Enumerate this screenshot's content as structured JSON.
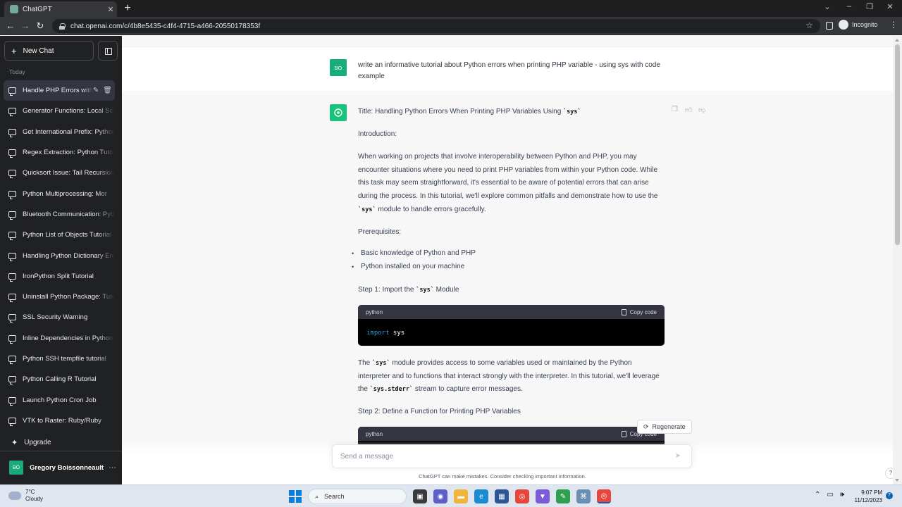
{
  "browser": {
    "tab_title": "ChatGPT",
    "url": "chat.openai.com/c/4b8e5435-c4f4-4715-a466-20550178353f",
    "profile_label": "Incognito"
  },
  "sidebar": {
    "new_chat_label": "New Chat",
    "section_label": "Today",
    "conversations": [
      "Handle PHP Errors with sys",
      "Generator Functions: Local Scope",
      "Get International Prefix: Python",
      "Regex Extraction: Python Tutorial",
      "Quicksort Issue: Tail Recursion",
      "Python Multiprocessing: Mor",
      "Bluetooth Communication: Python",
      "Python List of Objects Tutorial",
      "Handling Python Dictionary Errors",
      "IronPython Split Tutorial",
      "Uninstall Python Package: Tutorial",
      "SSL Security Warning",
      "Inline Dependencies in Python",
      "Python SSH tempfile tutorial",
      "Python Calling R Tutorial",
      "Launch Python Cron Job",
      "VTK to Raster: Ruby/Ruby"
    ],
    "upgrade_label": "Upgrade",
    "user_initials": "BO",
    "user_name": "Gregory Boissonneault"
  },
  "chat": {
    "user_initials": "BO",
    "user_message": "write an informative tutorial about Python errors when printing PHP variable - using sys with code example",
    "assistant": {
      "title_prefix": "Title: Handling Python Errors When Printing PHP Variables Using ",
      "title_code": "`sys`",
      "intro": "Introduction:",
      "para1_a": "When working on projects that involve interoperability between Python and PHP, you may encounter situations where you need to print PHP variables from within your Python code. While this task may seem straightforward, it's essential to be aware of potential errors that can arise during the process. In this tutorial, we'll explore common pitfalls and demonstrate how to use the ",
      "para1_code": "`sys`",
      "para1_b": " module to handle errors gracefully.",
      "prereq": "Prerequisites:",
      "bullets": [
        "Basic knowledge of Python and PHP",
        "Python installed on your machine"
      ],
      "step1_a": "Step 1: Import the ",
      "step1_code": "`sys`",
      "step1_b": " Module",
      "code1": {
        "lang": "python",
        "copy": "Copy code",
        "keyword": "import",
        "rest": " sys"
      },
      "para2_a": "The ",
      "para2_code1": "`sys`",
      "para2_b": " module provides access to some variables used or maintained by the Python interpreter and to functions that interact strongly with the interpreter. In this tutorial, we'll leverage the ",
      "para2_code2": "`sys.stderr`",
      "para2_c": " stream to capture error messages.",
      "step2": "Step 2: Define a Function for Printing PHP Variables",
      "code2": {
        "lang": "python",
        "copy": "Copy code"
      }
    },
    "regenerate_label": "Regenerate",
    "composer_placeholder": "Send a message",
    "disclaimer": "ChatGPT can make mistakes. Consider checking important information.",
    "help_label": "?"
  },
  "taskbar": {
    "temperature": "7°C",
    "weather": "Cloudy",
    "search_label": "Search",
    "time": "9:07 PM",
    "date": "11/12/2023",
    "notification_count": "7"
  }
}
